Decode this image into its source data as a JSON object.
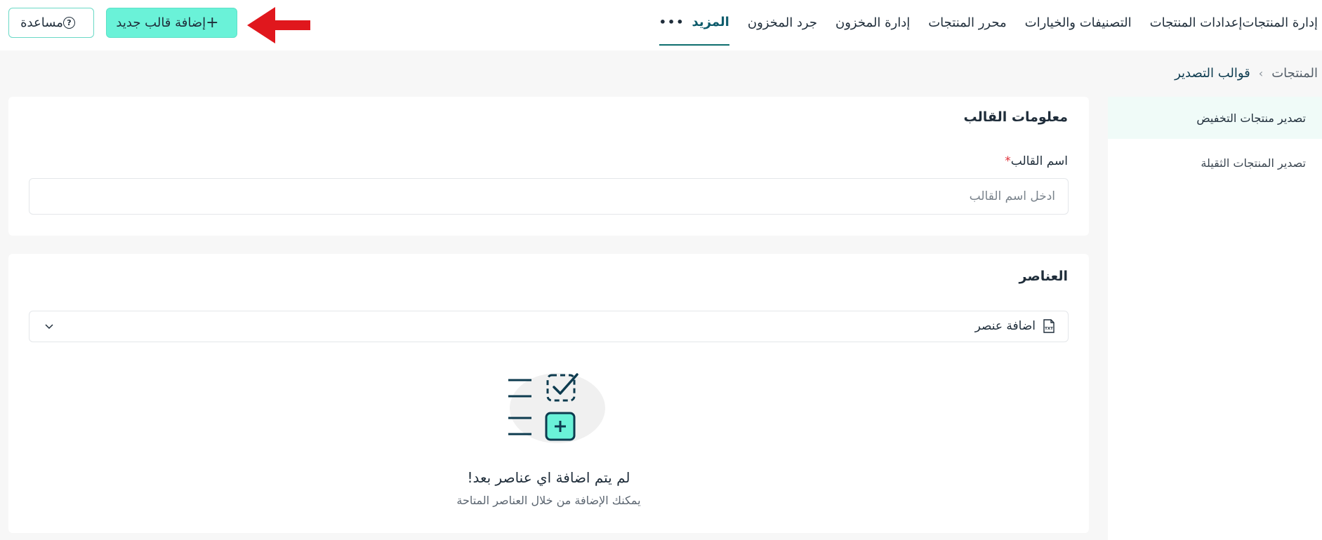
{
  "nav": {
    "items": [
      "إدارة المنتجات",
      "إعدادات المنتجات",
      "التصنيفات والخيارات",
      "محرر المنتجات",
      "إدارة المخزون",
      "جرد المخزون"
    ],
    "more_label": "المزيد"
  },
  "toolbar": {
    "add_template_label": "إضافة قالب جديد",
    "help_label": "مساعدة"
  },
  "breadcrumb": {
    "parent": "المنتجات",
    "current": "قوالب التصدير"
  },
  "sidebar": {
    "items": [
      "تصدير منتجات التخفيض",
      "تصدير المنتجات الثقيلة"
    ],
    "active_index": 0
  },
  "template_info": {
    "title": "معلومات القالب",
    "name_label": "اسم القالب",
    "required_mark": "*",
    "name_placeholder": "ادخل اسم القالب",
    "name_value": ""
  },
  "elements": {
    "title": "العناصر",
    "add_element_label": "اضافة عنصر",
    "empty_title": "لم يتم اضافة اي عناصر بعد!",
    "empty_subtitle": "يمكنك الإضافة من خلال العناصر المتاحة"
  },
  "colors": {
    "accent": "#6af2d8",
    "accent_dark": "#0d6e6e",
    "arrow": "#e0171d"
  },
  "icons": {
    "add": "plus-icon",
    "help": "question-circle-icon",
    "more": "dots-icon",
    "breadcrumb_sep": "chevron-left-icon",
    "add_element": "txt-file-icon",
    "dropdown": "chevron-down-icon"
  }
}
